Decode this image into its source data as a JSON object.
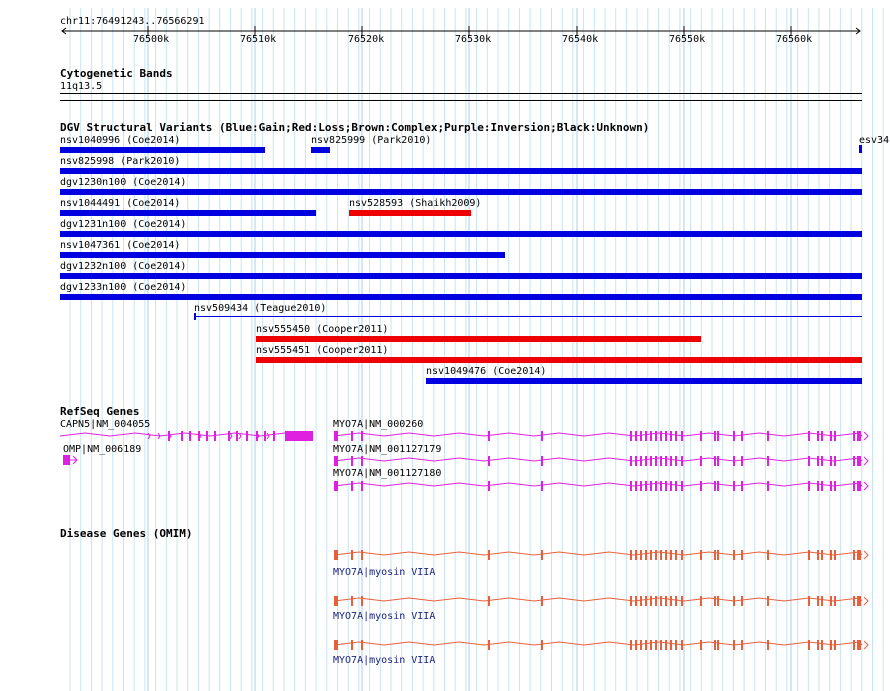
{
  "ruler": {
    "region": "chr11:76491243..76566291",
    "ticks": [
      "76500k",
      "76510k",
      "76520k",
      "76530k",
      "76540k",
      "76550k",
      "76560k"
    ]
  },
  "cytoband": {
    "title": "Cytogenetic Bands",
    "band": "11q13.5"
  },
  "dgv": {
    "title": "DGV Structural Variants (Blue:Gain;Red:Loss;Brown:Complex;Purple:Inversion;Black:Unknown)",
    "colors": {
      "gain": "#0000e0",
      "loss": "#ee0000"
    },
    "variants": [
      {
        "label": "nsv1040996 (Coe2014)",
        "type": "gain"
      },
      {
        "label": "nsv825999 (Park2010)",
        "type": "gain"
      },
      {
        "label": "esv34",
        "type": "gain"
      },
      {
        "label": "nsv825998 (Park2010)",
        "type": "gain"
      },
      {
        "label": "dgv1230n100 (Coe2014)",
        "type": "gain"
      },
      {
        "label": "nsv1044491 (Coe2014)",
        "type": "gain"
      },
      {
        "label": "nsv528593 (Shaikh2009)",
        "type": "loss"
      },
      {
        "label": "dgv1231n100 (Coe2014)",
        "type": "gain"
      },
      {
        "label": "nsv1047361 (Coe2014)",
        "type": "gain"
      },
      {
        "label": "dgv1232n100 (Coe2014)",
        "type": "gain"
      },
      {
        "label": "dgv1233n100 (Coe2014)",
        "type": "gain"
      },
      {
        "label": "nsv509434 (Teague2010)",
        "type": "gain"
      },
      {
        "label": "nsv555450 (Cooper2011)",
        "type": "loss"
      },
      {
        "label": "nsv555451 (Cooper2011)",
        "type": "loss"
      },
      {
        "label": "nsv1049476 (Coe2014)",
        "type": "gain"
      }
    ]
  },
  "refseq": {
    "title": "RefSeq Genes",
    "color": "#e020e0",
    "genes": [
      {
        "label": "CAPN5|NM_004055"
      },
      {
        "label": "OMP|NM_006189"
      },
      {
        "label": "MYO7A|NM_000260"
      },
      {
        "label": "MYO7A|NM_001127179"
      },
      {
        "label": "MYO7A|NM_001127180"
      }
    ]
  },
  "omim": {
    "title": "Disease Genes (OMIM)",
    "color": "#e8603a",
    "genes": [
      {
        "label": "MYO7A|myosin VIIA"
      },
      {
        "label": "MYO7A|myosin VIIA"
      },
      {
        "label": "MYO7A|myosin VIIA"
      }
    ]
  }
}
